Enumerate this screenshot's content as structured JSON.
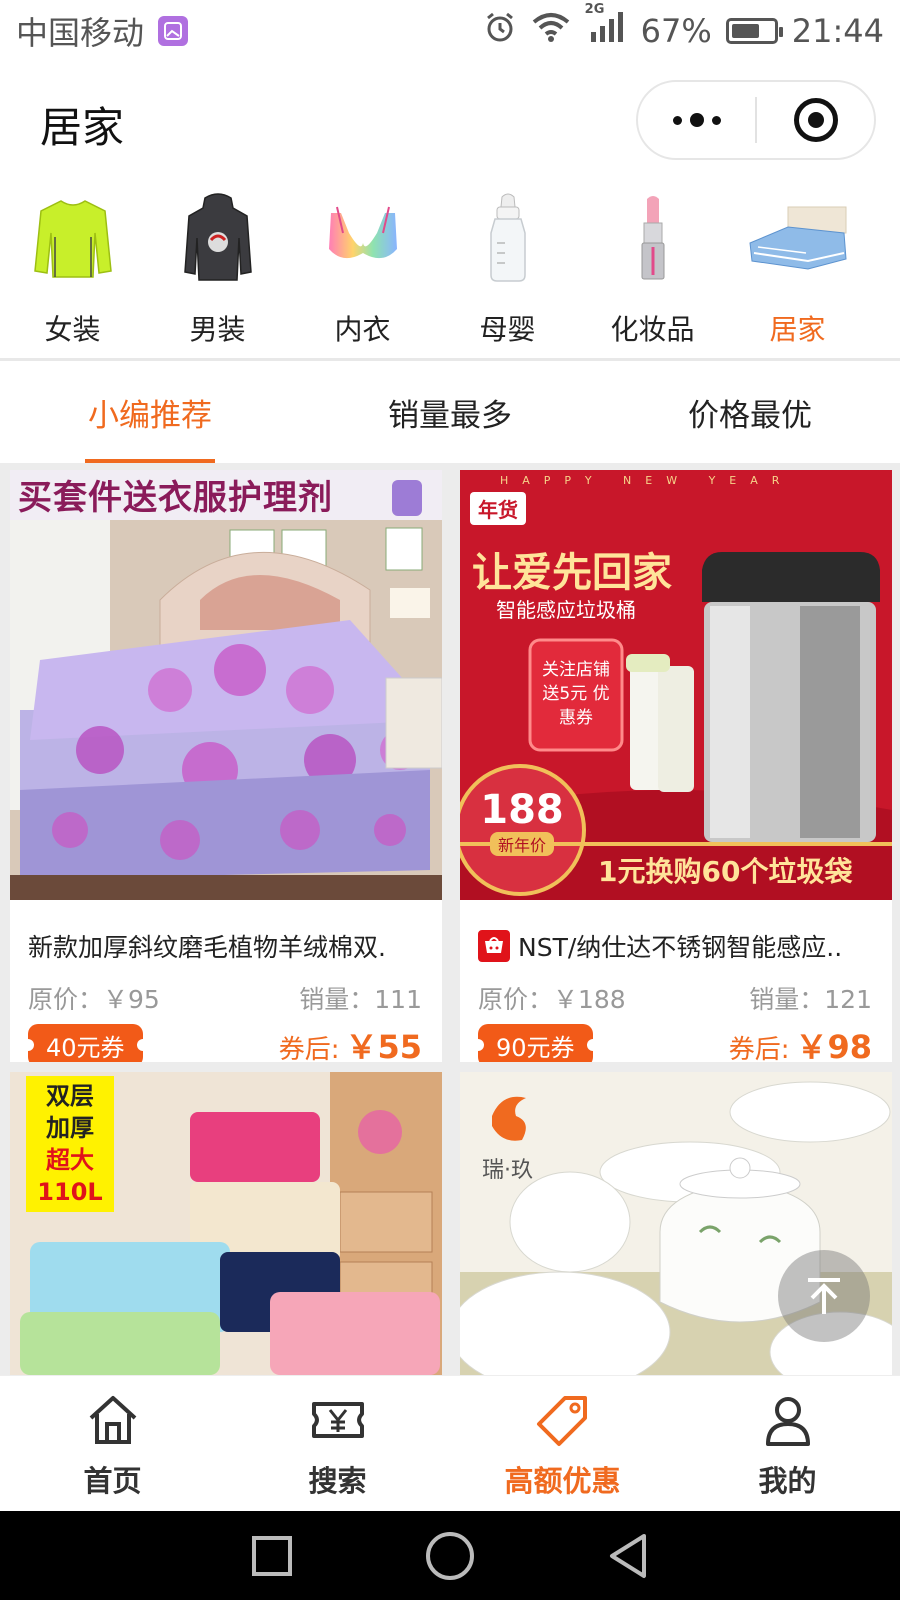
{
  "status_bar": {
    "carrier": "中国移动",
    "network": "2G",
    "battery": "67%",
    "battery_level": 0.67,
    "time": "21:44"
  },
  "nav": {
    "title": "居家"
  },
  "categories": [
    {
      "label": "女装",
      "icon": "sweater-icon",
      "active": false
    },
    {
      "label": "男装",
      "icon": "hoodie-icon",
      "active": false
    },
    {
      "label": "内衣",
      "icon": "bra-icon",
      "active": false
    },
    {
      "label": "母婴",
      "icon": "baby-bottle-icon",
      "active": false
    },
    {
      "label": "化妆品",
      "icon": "lipstick-icon",
      "active": false
    },
    {
      "label": "居家",
      "icon": "bedding-icon",
      "active": true
    }
  ],
  "sort_tabs": [
    {
      "label": "小编推荐",
      "active": true
    },
    {
      "label": "销量最多",
      "active": false
    },
    {
      "label": "价格最优",
      "active": false
    }
  ],
  "products": [
    {
      "image_banner": "买套件送衣服护理剂",
      "title": "新款加厚斜纹磨毛植物羊绒棉双.",
      "original_price": "原价：￥95",
      "sales": "销量：111",
      "coupon": "40元券",
      "after_label": "券后:",
      "after_price": "￥55"
    },
    {
      "image_banner": "让爱先回家",
      "image_sub": "智能感应垃圾桶",
      "image_tag": "年货",
      "image_price": "188",
      "image_price_tag": "新年价",
      "image_promo": "1元换购60个垃圾袋",
      "image_coupon": "关注店铺 送5元 优惠券",
      "image_happy": "HAPPY NEW YEAR",
      "title": "NST/纳仕达不锈钢智能感应..",
      "original_price": "原价：￥188",
      "sales": "销量：121",
      "coupon": "90元券",
      "after_label": "券后:",
      "after_price": "￥98"
    },
    {
      "image_badge": [
        "双层",
        "加厚",
        "超大",
        "110L"
      ]
    },
    {
      "image_brand": "瑞·玖"
    }
  ],
  "tab_bar": [
    {
      "label": "首页",
      "icon": "home-icon",
      "active": false
    },
    {
      "label": "搜索",
      "icon": "coupon-yen-icon",
      "active": false
    },
    {
      "label": "高额优惠",
      "icon": "price-tag-icon",
      "active": true
    },
    {
      "label": "我的",
      "icon": "user-icon",
      "active": false
    }
  ],
  "colors": {
    "accent": "#f06a1f",
    "coupon": "#f25a18",
    "divider": "#ececec"
  }
}
